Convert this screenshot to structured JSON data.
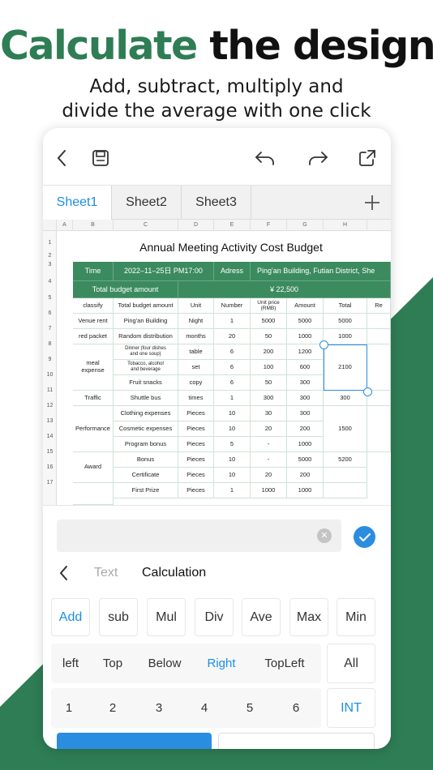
{
  "headline": {
    "part1": "Calculate",
    "part2": "the design"
  },
  "subtitle": {
    "line1": "Add, subtract, multiply and",
    "line2": "divide the average with one click"
  },
  "colors": {
    "brand_green": "#2e7d55",
    "accent_blue": "#1a8fe3",
    "header_green": "#3b8b5f"
  },
  "toolbar": {
    "icons": [
      "back-icon",
      "save-icon",
      "undo-icon",
      "redo-icon",
      "share-icon"
    ]
  },
  "tabs": {
    "items": [
      "Sheet1",
      "Sheet2",
      "Sheet3"
    ],
    "active": "Sheet1",
    "add_icon": "plus-icon"
  },
  "sheet": {
    "columns": [
      "A",
      "B",
      "C",
      "D",
      "E",
      "F",
      "G",
      "H"
    ],
    "rows": [
      "1",
      "2",
      "3",
      "4",
      "5",
      "6",
      "7",
      "8",
      "9",
      "10",
      "11",
      "12",
      "13",
      "14",
      "15",
      "16",
      "17"
    ],
    "title": "Annual Meeting Activity Cost Budget",
    "header_row": {
      "time_label": "Time",
      "time_value": "2022–11–25日 PM17:00",
      "adress_label": "Adress",
      "adress_value": "Ping'an Building, Futian District, She"
    },
    "budget_row": {
      "label": "Total budget amount",
      "value": "¥ 22,500"
    },
    "col_headers": [
      "classify",
      "Total budget amount",
      "Unit",
      "Number",
      "Unit price\n(RMB)",
      "Amount",
      "Total",
      "Re"
    ],
    "data": {
      "r6": [
        "Venue rent",
        "Ping'an Building",
        "Night",
        "1",
        "5000",
        "5000",
        "5000"
      ],
      "r7": [
        "red packet",
        "Random distribution",
        "months",
        "20",
        "50",
        "1000",
        "1000"
      ],
      "meal_label": "meal\nexpense",
      "r8": [
        "Dinner (four dishes\nand one soup)",
        "table",
        "6",
        "200",
        "1200"
      ],
      "r9": [
        "Tobacco, alcohol\nand beverage",
        "set",
        "6",
        "100",
        "600"
      ],
      "r10": [
        "Fruit snacks",
        "copy",
        "6",
        "50",
        "300"
      ],
      "meal_total": "2100",
      "r11": [
        "Traffic",
        "Shuttle bus",
        "times",
        "1",
        "300",
        "300",
        "300"
      ],
      "performance_label": "Performance",
      "r12": [
        "Clothing expenses",
        "Pieces",
        "10",
        "30",
        "300"
      ],
      "r13": [
        "Cosmetic expenses",
        "Pieces",
        "10",
        "20",
        "200"
      ],
      "r14": [
        "Program bonus",
        "Pieces",
        "5",
        "-",
        "1000"
      ],
      "performance_total": "1500",
      "award_label": "Award",
      "r15": [
        "Bonus",
        "Pieces",
        "10",
        "-",
        "5000"
      ],
      "r16": [
        "Certificate",
        "Pieces",
        "10",
        "20",
        "200"
      ],
      "r17": [
        "First Prize",
        "Pieces",
        "1",
        "1000",
        "1000"
      ],
      "award_total": "5200"
    }
  },
  "panel": {
    "formula_value": "",
    "mode_text": "Text",
    "mode_calc": "Calculation",
    "ops": [
      "Add",
      "sub",
      "Mul",
      "Div",
      "Ave",
      "Max",
      "Min"
    ],
    "active_op": "Add",
    "directions": [
      "left",
      "Top",
      "Below",
      "Right",
      "TopLeft"
    ],
    "active_direction": "Right",
    "all_label": "All",
    "digits": [
      "1",
      "2",
      "3",
      "4",
      "5",
      "6"
    ],
    "int_label": "INT"
  }
}
